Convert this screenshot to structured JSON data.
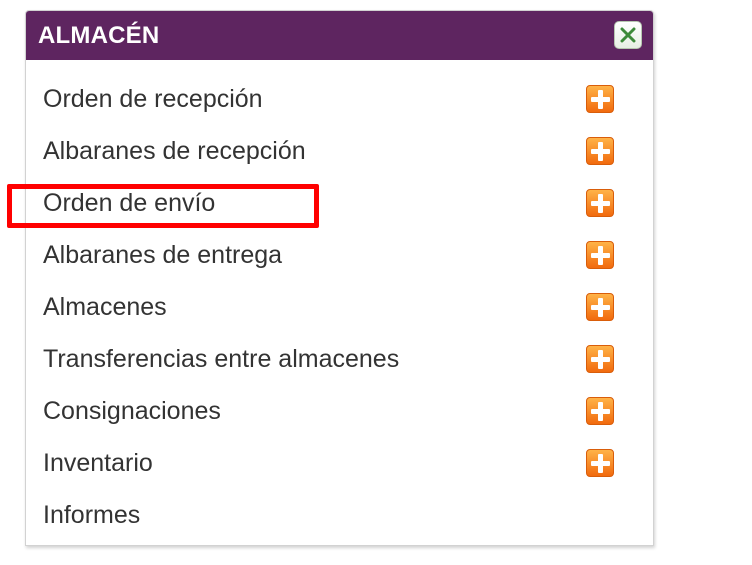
{
  "panel": {
    "title": "ALMACÉN",
    "close_icon": "close-x-icon",
    "header_color": "#5e2560"
  },
  "menu": {
    "items": [
      {
        "label": "Orden de recepción",
        "has_add": true,
        "add_icon": "add-plus-icon"
      },
      {
        "label": "Albaranes de recepción",
        "has_add": true,
        "add_icon": "add-plus-icon"
      },
      {
        "label": "Orden de envío",
        "has_add": true,
        "add_icon": "add-plus-icon"
      },
      {
        "label": "Albaranes de entrega",
        "has_add": true,
        "add_icon": "add-plus-icon"
      },
      {
        "label": "Almacenes",
        "has_add": true,
        "add_icon": "add-plus-icon"
      },
      {
        "label": "Transferencias entre almacenes",
        "has_add": true,
        "add_icon": "add-plus-icon"
      },
      {
        "label": "Consignaciones",
        "has_add": true,
        "add_icon": "add-plus-icon"
      },
      {
        "label": "Inventario",
        "has_add": true,
        "add_icon": "add-plus-icon"
      },
      {
        "label": "Informes",
        "has_add": false
      }
    ]
  },
  "annotation": {
    "highlight_color": "#ff0000",
    "highlighted_item": "Orden de envío"
  }
}
